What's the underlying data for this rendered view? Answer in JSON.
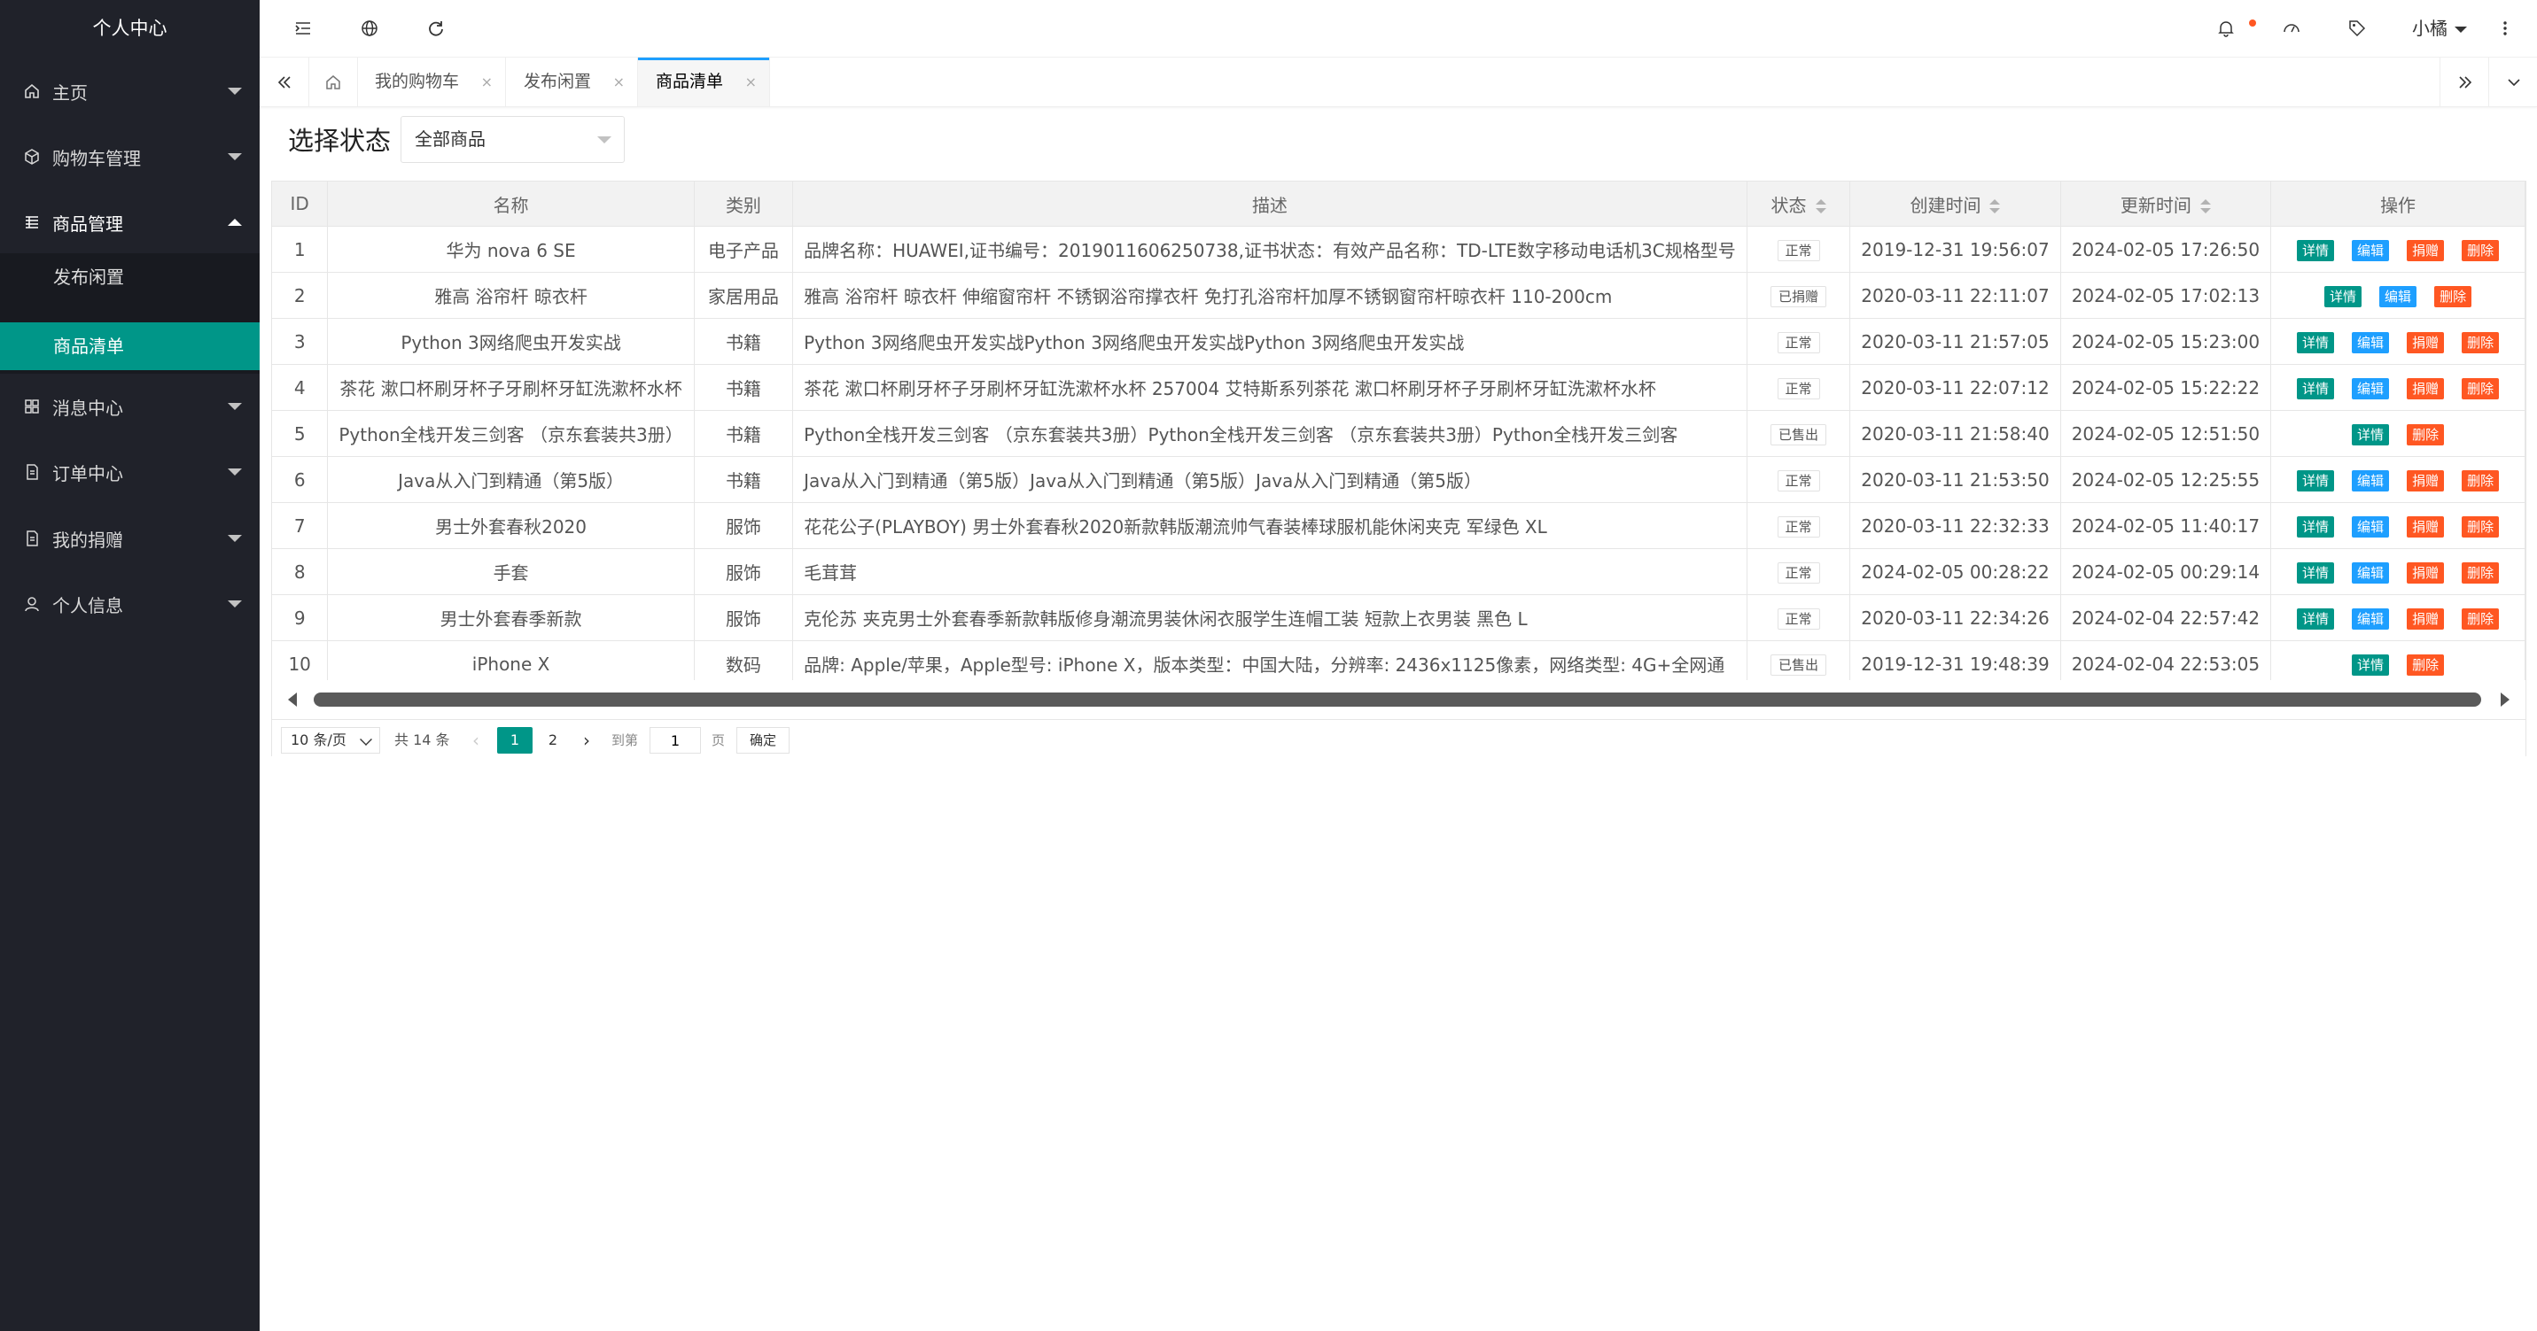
{
  "sidebar": {
    "title": "个人中心",
    "items": [
      {
        "label": "主页",
        "icon": "home-icon"
      },
      {
        "label": "购物车管理",
        "icon": "cube-icon"
      },
      {
        "label": "商品管理",
        "icon": "list-icon"
      },
      {
        "label": "消息中心",
        "icon": "app-icon"
      },
      {
        "label": "订单中心",
        "icon": "doc-icon"
      },
      {
        "label": "我的捐赠",
        "icon": "doc-icon"
      },
      {
        "label": "个人信息",
        "icon": "user-icon"
      }
    ],
    "subitems": [
      {
        "label": "发布闲置"
      },
      {
        "label": "商品清单"
      }
    ]
  },
  "topbar": {
    "user": "小橘",
    "icons": [
      "menu-fold-icon",
      "globe-icon",
      "refresh-icon",
      "bell-icon",
      "dashboard-icon",
      "tag-icon",
      "more-vertical-icon"
    ]
  },
  "tabs": [
    {
      "label": "我的购物车"
    },
    {
      "label": "发布闲置"
    },
    {
      "label": "商品清单"
    }
  ],
  "filter": {
    "label": "选择状态",
    "selected": "全部商品"
  },
  "table": {
    "headers": [
      "ID",
      "名称",
      "类别",
      "描述",
      "状态",
      "创建时间",
      "更新时间",
      "操作"
    ],
    "actions": {
      "detail": "详情",
      "edit": "编辑",
      "donate": "捐赠",
      "delete": "删除"
    },
    "rows": [
      {
        "id": "1",
        "name": "华为 nova 6 SE",
        "category": "电子产品",
        "desc": "品牌名称：HUAWEI,证书编号：2019011606250738,证书状态：有效产品名称：TD-LTE数字移动电话机3C规格型号",
        "status": "正常",
        "created": "2019-12-31 19:56:07",
        "updated": "2024-02-05 17:26:50"
      },
      {
        "id": "2",
        "name": "雅高 浴帘杆 晾衣杆",
        "category": "家居用品",
        "desc": "雅高 浴帘杆 晾衣杆 伸缩窗帘杆 不锈钢浴帘撑衣杆 免打孔浴帘杆加厚不锈钢窗帘杆晾衣杆 110-200cm",
        "status": "已捐赠",
        "created": "2020-03-11 22:11:07",
        "updated": "2024-02-05 17:02:13"
      },
      {
        "id": "3",
        "name": "Python 3网络爬虫开发实战",
        "category": "书籍",
        "desc": "Python 3网络爬虫开发实战Python 3网络爬虫开发实战Python 3网络爬虫开发实战",
        "status": "正常",
        "created": "2020-03-11 21:57:05",
        "updated": "2024-02-05 15:23:00"
      },
      {
        "id": "4",
        "name": "茶花 漱口杯刷牙杯子牙刷杯牙缸洗漱杯水杯",
        "category": "书籍",
        "desc": "茶花 漱口杯刷牙杯子牙刷杯牙缸洗漱杯水杯 257004 艾特斯系列茶花 漱口杯刷牙杯子牙刷杯牙缸洗漱杯水杯",
        "status": "正常",
        "created": "2020-03-11 22:07:12",
        "updated": "2024-02-05 15:22:22"
      },
      {
        "id": "5",
        "name": "Python全栈开发三剑客 （京东套装共3册）",
        "category": "书籍",
        "desc": "Python全栈开发三剑客 （京东套装共3册）Python全栈开发三剑客 （京东套装共3册）Python全栈开发三剑客",
        "status": "已售出",
        "created": "2020-03-11 21:58:40",
        "updated": "2024-02-05 12:51:50"
      },
      {
        "id": "6",
        "name": "Java从入门到精通（第5版）",
        "category": "书籍",
        "desc": "Java从入门到精通（第5版）Java从入门到精通（第5版）Java从入门到精通（第5版）",
        "status": "正常",
        "created": "2020-03-11 21:53:50",
        "updated": "2024-02-05 12:25:55"
      },
      {
        "id": "7",
        "name": "男士外套春秋2020",
        "category": "服饰",
        "desc": "花花公子(PLAYBOY) 男士外套春秋2020新款韩版潮流帅气春装棒球服机能休闲夹克 军绿色 XL",
        "status": "正常",
        "created": "2020-03-11 22:32:33",
        "updated": "2024-02-05 11:40:17"
      },
      {
        "id": "8",
        "name": "手套",
        "category": "服饰",
        "desc": "毛茸茸",
        "status": "正常",
        "created": "2024-02-05 00:28:22",
        "updated": "2024-02-05 00:29:14"
      },
      {
        "id": "9",
        "name": "男士外套春季新款",
        "category": "服饰",
        "desc": "克伦苏 夹克男士外套春季新款韩版修身潮流男装休闲衣服学生连帽工装 短款上衣男装 黑色 L",
        "status": "正常",
        "created": "2020-03-11 22:34:26",
        "updated": "2024-02-04 22:57:42"
      },
      {
        "id": "10",
        "name": "iPhone X",
        "category": "数码",
        "desc": "品牌: Apple/苹果，Apple型号: iPhone X，版本类型：中国大陆，分辨率: 2436x1125像素，网络类型: 4G+全网通",
        "status": "已售出",
        "created": "2019-12-31 19:48:39",
        "updated": "2024-02-04 22:53:05"
      }
    ]
  },
  "pager": {
    "page_size": "10 条/页",
    "total": "共 14 条",
    "pages": [
      "1",
      "2"
    ],
    "goto_label": "到第",
    "goto_value": "1",
    "page_label": "页",
    "confirm": "确定"
  }
}
